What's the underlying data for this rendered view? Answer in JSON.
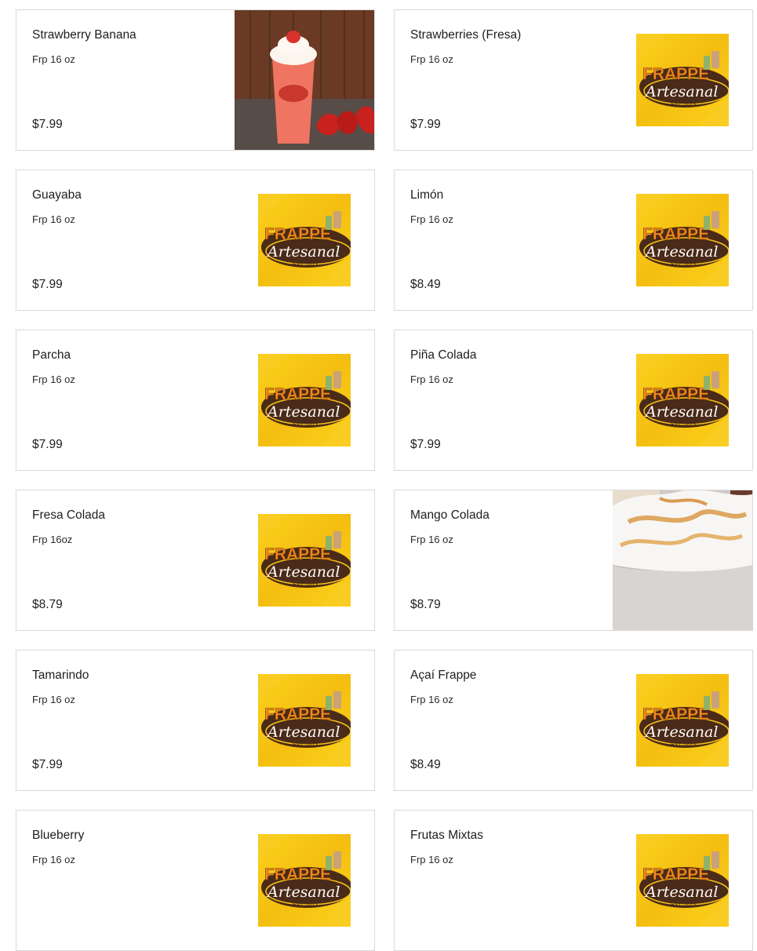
{
  "menu": {
    "items": [
      {
        "name": "Strawberry Banana",
        "description": "Frp 16 oz",
        "price": "$7.99",
        "image": "strawberry-frappe-photo"
      },
      {
        "name": "Strawberries (Fresa)",
        "description": "Frp 16 oz",
        "price": "$7.99",
        "image": "frappe-artesanal-logo"
      },
      {
        "name": "Guayaba",
        "description": "Frp 16 oz",
        "price": "$7.99",
        "image": "frappe-artesanal-logo"
      },
      {
        "name": "Limón",
        "description": "Frp 16 oz",
        "price": "$8.49",
        "image": "frappe-artesanal-logo"
      },
      {
        "name": "Parcha",
        "description": "Frp 16 oz",
        "price": "$7.99",
        "image": "frappe-artesanal-logo"
      },
      {
        "name": "Piña Colada",
        "description": "Frp 16 oz",
        "price": "$7.99",
        "image": "frappe-artesanal-logo"
      },
      {
        "name": "Fresa Colada",
        "description": "Frp 16oz",
        "price": "$8.79",
        "image": "frappe-artesanal-logo"
      },
      {
        "name": "Mango Colada",
        "description": "Frp 16 oz",
        "price": "$8.79",
        "image": "whipped-cream-cup-photo"
      },
      {
        "name": "Tamarindo",
        "description": "Frp 16 oz",
        "price": "$7.99",
        "image": "frappe-artesanal-logo"
      },
      {
        "name": "Açaí Frappe",
        "description": "Frp 16 oz",
        "price": "$8.49",
        "image": "frappe-artesanal-logo"
      },
      {
        "name": "Blueberry",
        "description": "Frp 16 oz",
        "price": "",
        "image": "frappe-artesanal-logo"
      },
      {
        "name": "Frutas Mixtas",
        "description": "Frp 16 oz",
        "price": "",
        "image": "frappe-artesanal-logo"
      }
    ]
  },
  "logo": {
    "line1": "FRAPPE",
    "line2": "Artesanal",
    "line3": "EST. 2013"
  },
  "colors": {
    "card_border": "#d9d9d9",
    "logo_yellow": "#f6c316",
    "logo_orange": "#f08a1c",
    "logo_brown": "#4a2a18"
  }
}
